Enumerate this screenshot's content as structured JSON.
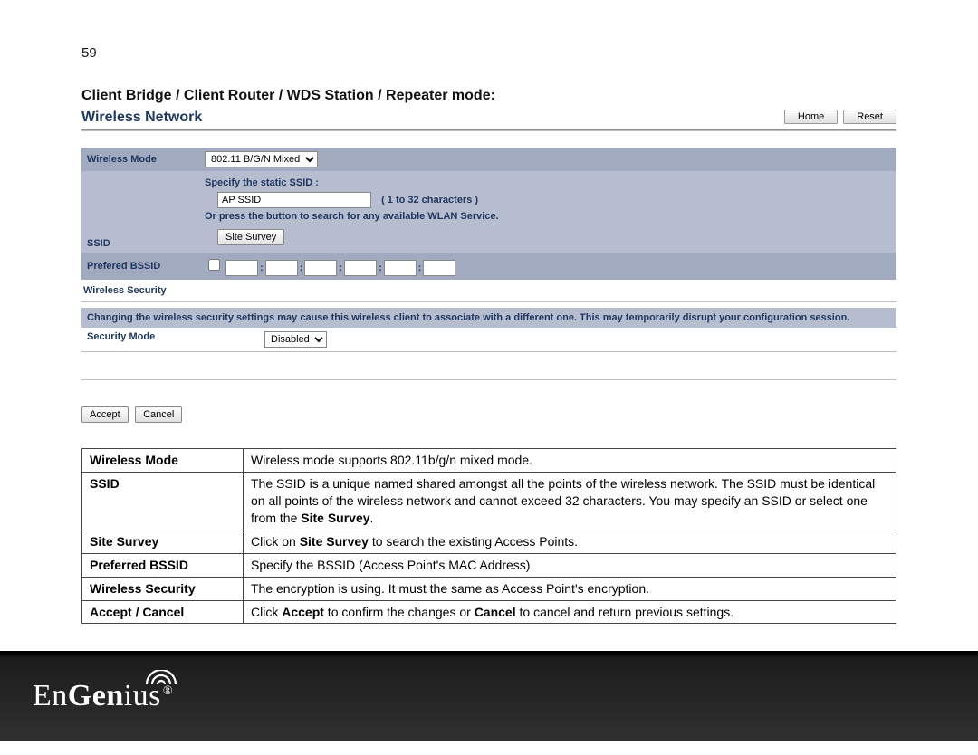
{
  "page_number": "59",
  "section_title": "Client Bridge / Client Router / WDS Station / Repeater mode:",
  "panel": {
    "title": "Wireless Network",
    "home_btn": "Home",
    "reset_btn": "Reset"
  },
  "form": {
    "wireless_mode_label": "Wireless Mode",
    "wireless_mode_value": "802.11 B/G/N Mixed",
    "ssid_label": "SSID",
    "specify_ssid_text": "Specify the static SSID  :",
    "ssid_value": "AP SSID",
    "chars_note": "( 1 to 32 characters )",
    "or_press_text": "Or press the button to search for any available WLAN Service.",
    "site_survey_btn": "Site Survey",
    "prefered_bssid_label": "Prefered BSSID",
    "wireless_security_heading": "Wireless Security",
    "warning_text": "Changing the wireless security settings may cause this wireless client to associate with a different one. This may temporarily disrupt your configuration session.",
    "security_mode_label": "Security Mode",
    "security_mode_value": "Disabled",
    "accept_btn": "Accept",
    "cancel_btn": "Cancel"
  },
  "desc": [
    {
      "key": "Wireless Mode",
      "val_html": "Wireless mode supports 802.11b/g/n mixed mode."
    },
    {
      "key": "SSID",
      "val_html": "The SSID is a unique named shared amongst all the points of the wireless network. The SSID must be identical on all points of the wireless network and cannot exceed 32 characters. You may specify an SSID or select one from the <b>Site Survey</b>."
    },
    {
      "key": "Site Survey",
      "val_html": "Click on <b>Site Survey</b> to search the existing Access Points."
    },
    {
      "key": "Preferred BSSID",
      "val_html": "Specify the BSSID (Access Point's MAC Address)."
    },
    {
      "key": "Wireless Security",
      "val_html": "The encryption is using. It must the same as Access Point's encryption."
    },
    {
      "key": "Accept / Cancel",
      "val_html": "Click <b>Accept</b> to confirm the changes or <b>Cancel</b> to cancel and return previous settings."
    }
  ],
  "logo_suffix": "®"
}
